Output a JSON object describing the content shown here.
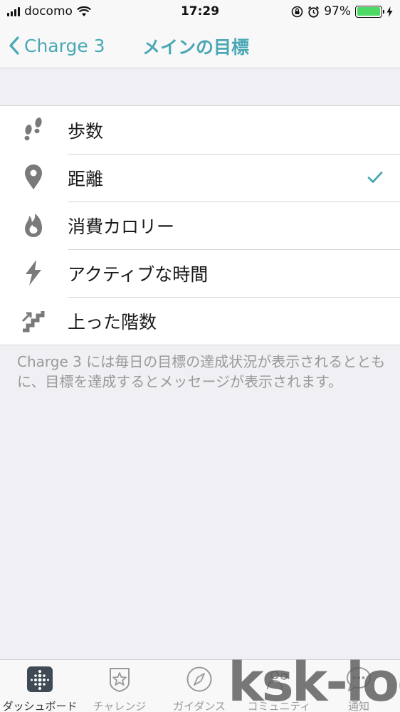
{
  "status_bar": {
    "carrier": "docomo",
    "time": "17:29",
    "battery_percent_label": "97%",
    "battery_level": 0.97,
    "battery_color": "#4cd964",
    "icons": [
      "signal-icon",
      "wifi-icon",
      "orientation-lock-icon",
      "alarm-icon",
      "charging-icon"
    ]
  },
  "nav": {
    "back_label": "Charge 3",
    "title": "メインの目標",
    "accent_color": "#4aa8b5"
  },
  "goals": [
    {
      "label": "歩数",
      "icon": "footsteps-icon",
      "selected": false
    },
    {
      "label": "距離",
      "icon": "location-pin-icon",
      "selected": true
    },
    {
      "label": "消費カロリー",
      "icon": "flame-icon",
      "selected": false
    },
    {
      "label": "アクティブな時間",
      "icon": "lightning-icon",
      "selected": false
    },
    {
      "label": "上った階数",
      "icon": "stairs-icon",
      "selected": false
    }
  ],
  "description": "Charge 3 には毎日の目標の達成状況が表示されるとともに、目標を達成するとメッセージが表示されます。",
  "tabs": [
    {
      "label": "ダッシュボード",
      "icon": "dashboard-icon",
      "active": true
    },
    {
      "label": "チャレンジ",
      "icon": "star-badge-icon",
      "active": false
    },
    {
      "label": "ガイダンス",
      "icon": "compass-icon",
      "active": false
    },
    {
      "label": "コミュニティ",
      "icon": "community-icon",
      "active": false
    },
    {
      "label": "通知",
      "icon": "chat-bubble-icon",
      "active": false
    }
  ],
  "watermark": "ksk-log"
}
